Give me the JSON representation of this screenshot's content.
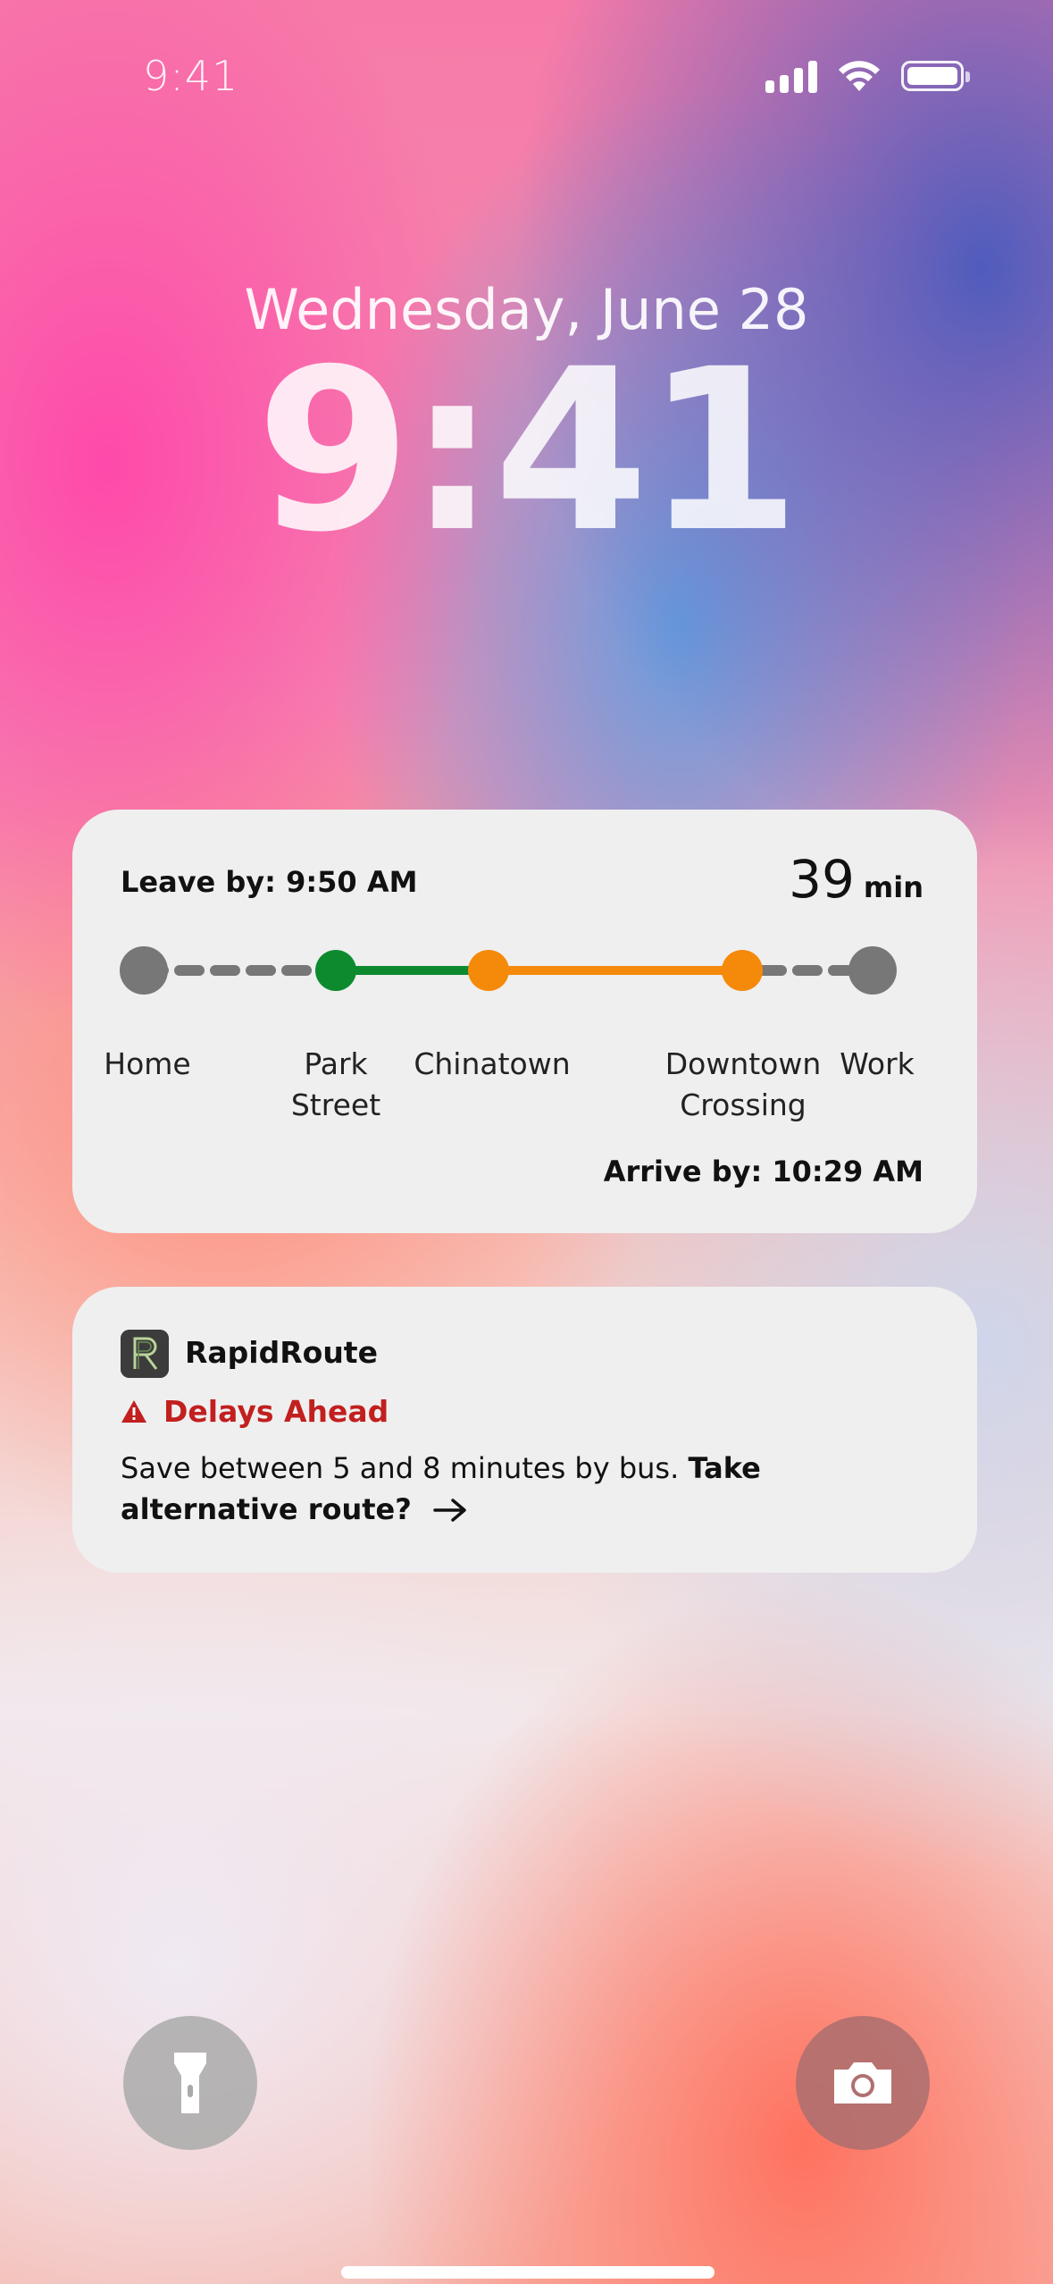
{
  "status_bar": {
    "time": "9:41"
  },
  "lock": {
    "date": "Wednesday, June 28",
    "time": "9:41"
  },
  "widget": {
    "leave_by": "Leave by: 9:50 AM",
    "duration_value": "39",
    "duration_unit": "min",
    "arrive_by": "Arrive by: 10:29 AM",
    "stops": [
      {
        "label": "Home",
        "label2": ""
      },
      {
        "label": "Park",
        "label2": "Street"
      },
      {
        "label": "Chinatown",
        "label2": ""
      },
      {
        "label": "Downtown",
        "label2": "Crossing"
      },
      {
        "label": "Work",
        "label2": ""
      }
    ],
    "colors": {
      "walk": "#777777",
      "green_line": "#0e8a2e",
      "orange_line": "#f5890a"
    }
  },
  "notification": {
    "app_name": "RapidRoute",
    "title": "Delays Ahead",
    "body_plain": "Save between 5 and 8 minutes by bus. ",
    "body_bold": "Take alternative route?",
    "alert_color": "#c21f1f"
  },
  "bottom": {
    "left_button": "flashlight-icon",
    "right_button": "camera-icon"
  }
}
